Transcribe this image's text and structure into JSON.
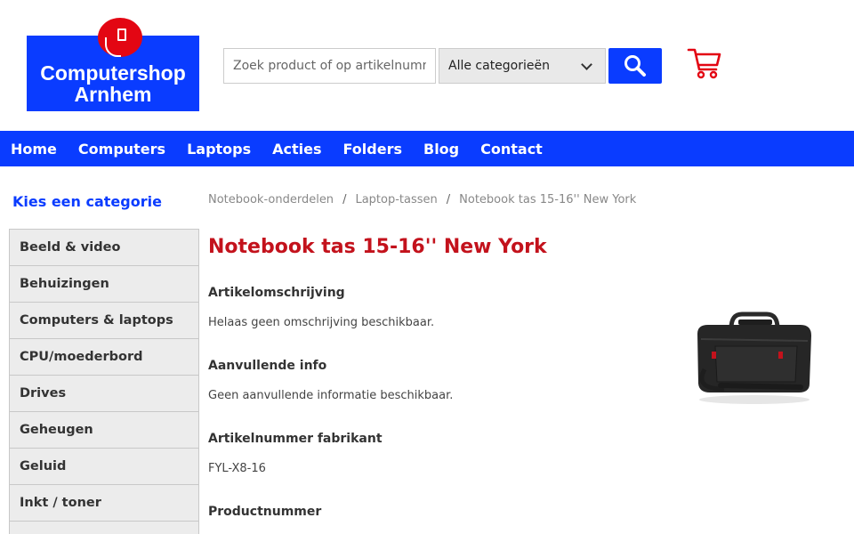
{
  "logo": {
    "line1": "Computershop",
    "line2": "Arnhem"
  },
  "search": {
    "placeholder": "Zoek product of op artikelnummer",
    "category_selected": "Alle categorieën"
  },
  "nav": [
    "Home",
    "Computers",
    "Laptops",
    "Acties",
    "Folders",
    "Blog",
    "Contact"
  ],
  "sidebar": {
    "title": "Kies een categorie",
    "items": [
      "Beeld & video",
      "Behuizingen",
      "Computers & laptops",
      "CPU/moederbord",
      "Drives",
      "Geheugen",
      "Geluid",
      "Inkt / toner"
    ]
  },
  "breadcrumb": [
    "Notebook-onderdelen",
    "Laptop-tassen",
    "Notebook tas 15-16'' New York"
  ],
  "product": {
    "title": "Notebook tas 15-16'' New York",
    "description_heading": "Artikelomschrijving",
    "description": "Helaas geen omschrijving beschikbaar.",
    "info_heading": "Aanvullende info",
    "info": "Geen aanvullende informatie beschikbaar.",
    "mfr_heading": "Artikelnummer fabrikant",
    "mfr_number": "FYL-X8-16",
    "product_number_heading": "Productnummer"
  },
  "colors": {
    "brand_blue": "#0a3cff",
    "title_red": "#c3121c",
    "logo_red": "#e30613"
  },
  "icons": {
    "search": "search-icon",
    "cart": "cart-icon",
    "dropdown": "chevron-down-icon"
  }
}
